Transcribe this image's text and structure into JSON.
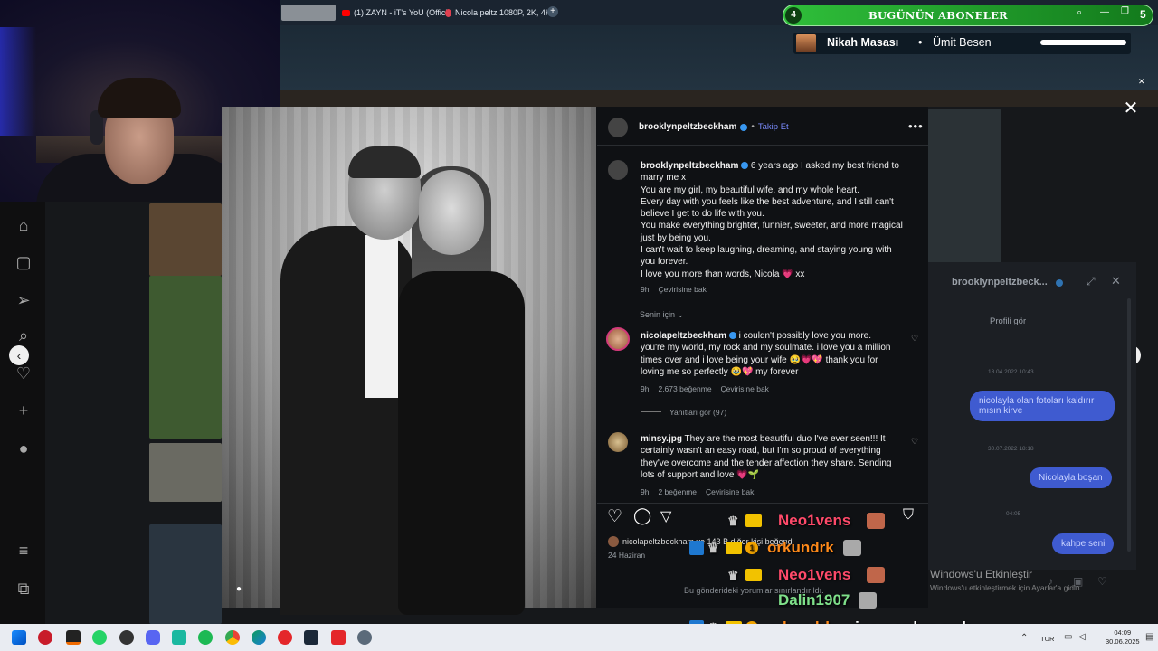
{
  "browser": {
    "tabs": [
      {
        "label": "(1) ZAYN - iT's YoU (Offici",
        "color": "#ff0000"
      },
      {
        "label": "Nicola peltz 1080P, 2K, 4K",
        "color": "#e04050"
      }
    ]
  },
  "post": {
    "author": "brooklynpeltzbeckham",
    "follow_label": "Takip Et",
    "caption": {
      "username": "brooklynpeltzbeckham",
      "lines": [
        "6 years ago I asked my best friend to",
        "marry me x",
        "You are my girl, my beautiful wife, and my whole heart.",
        "Every day with you feels like the best adventure, and I still can't",
        "believe I get to do life with you.",
        "You make everything brighter, funnier, sweeter, and more magical",
        "just by being you.",
        "I can't wait to keep laughing, dreaming, and staying young with",
        "you forever.",
        "I love you more than words, Nicola 💗 xx"
      ],
      "time": "9h",
      "translate": "Çevirisine bak"
    },
    "for_you_label": "Senin için",
    "comments": [
      {
        "username": "nicolapeltzbeckham",
        "lines": [
          "i couldn't possibly love you more.",
          "you're my world, my rock and my soulmate. i love you a million",
          "times over and i love being your wife 🥹💗💖 thank you for",
          "loving me so perfectly 🥹💖 my forever"
        ],
        "time": "9h",
        "likes": "2.673 beğenme",
        "translate": "Çevirisine bak",
        "replies": "Yanıtları gör (97)"
      },
      {
        "username": "minsy.jpg",
        "lines": [
          "They are the most beautiful duo I've ever seen!!! It",
          "certainly wasn't an easy road, but I'm so proud of everything",
          "they've overcome and the tender affection they share. Sending",
          "lots of support and love 💗🌱"
        ],
        "time": "9h",
        "likes": "2 beğenme",
        "translate": "Çevirisine bak"
      }
    ],
    "liked_by": "nicolapeltzbeckham ve 143 B diğer kişi beğendi",
    "date": "24 Haziran",
    "comments_limited": "Bu gönderideki yorumlar sınırlandırıldı."
  },
  "dm": {
    "title": "brooklynpeltzbeck...",
    "profile_label": "Profili gör",
    "time1": "18.04.2022 10:43",
    "bubble1": "nicolayla olan fotoları kaldırır mısın kirve",
    "time2": "30.07.2022 18:18",
    "bubble2": "Nicolayla boşan",
    "time3": "04:05",
    "bubble3": "kahpe seni"
  },
  "stream": {
    "sub_count": "4",
    "sub_title": "BUGÜNÜN ABONELER",
    "sub_corner": "5",
    "music_title": "Nikah Masası",
    "music_sep": "•",
    "music_artist": "Ümit Besen",
    "chat": [
      {
        "user": "Neo1vens",
        "color": "#ff4a6a",
        "message": ""
      },
      {
        "user": "orkundrk",
        "color": "#ff8a1a",
        "message": ""
      },
      {
        "user": "Neo1vens",
        "color": "#ff4a6a",
        "message": ""
      },
      {
        "user": "Dalin1907",
        "color": "#7fe08a",
        "message": ""
      },
      {
        "user": "orkundrk",
        "color": "#ff8a1a",
        "message": "sigara yakın amk"
      }
    ]
  },
  "windows": {
    "activate_title": "Windows'u Etkinleştir",
    "activate_sub": "Windows'u etkinleştirmek için Ayarlar'a gidin.",
    "lang": "TUR",
    "time": "04:09",
    "date": "30.06.2025"
  },
  "colors": {
    "accent_follow": "#7b8cff",
    "verified": "#3897f0"
  }
}
